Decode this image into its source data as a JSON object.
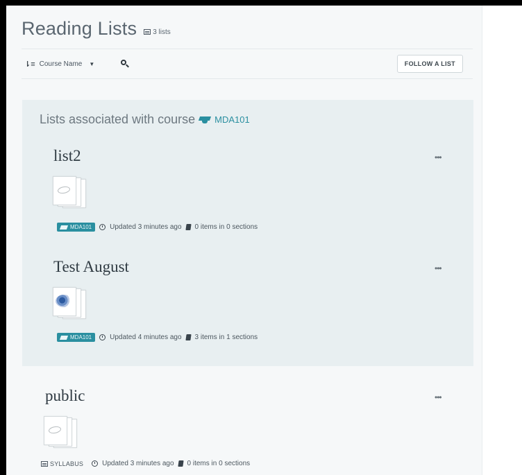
{
  "header": {
    "title": "Reading Lists",
    "count_label": "3 lists"
  },
  "toolbar": {
    "sort_label": "Course Name",
    "follow_label": "FOLLOW A LIST"
  },
  "course_section": {
    "heading": "Lists associated with course",
    "course_code": "MDA101"
  },
  "lists": [
    {
      "title": "list2",
      "course_tag": "MDA101",
      "updated": "Updated 3 minutes ago",
      "items": "0 items in 0 sections",
      "more": "•••"
    },
    {
      "title": "Test August",
      "course_tag": "MDA101",
      "updated": "Updated 4 minutes ago",
      "items": "3 items in 1 sections",
      "more": "•••"
    },
    {
      "title": "public",
      "type_tag": "SYLLABUS",
      "updated": "Updated 3 minutes ago",
      "items": "0 items in 0 sections",
      "more": "•••"
    }
  ],
  "colors": {
    "accent": "#2a8fa0",
    "panel": "#e8eff1",
    "page": "#f6f8f9"
  }
}
